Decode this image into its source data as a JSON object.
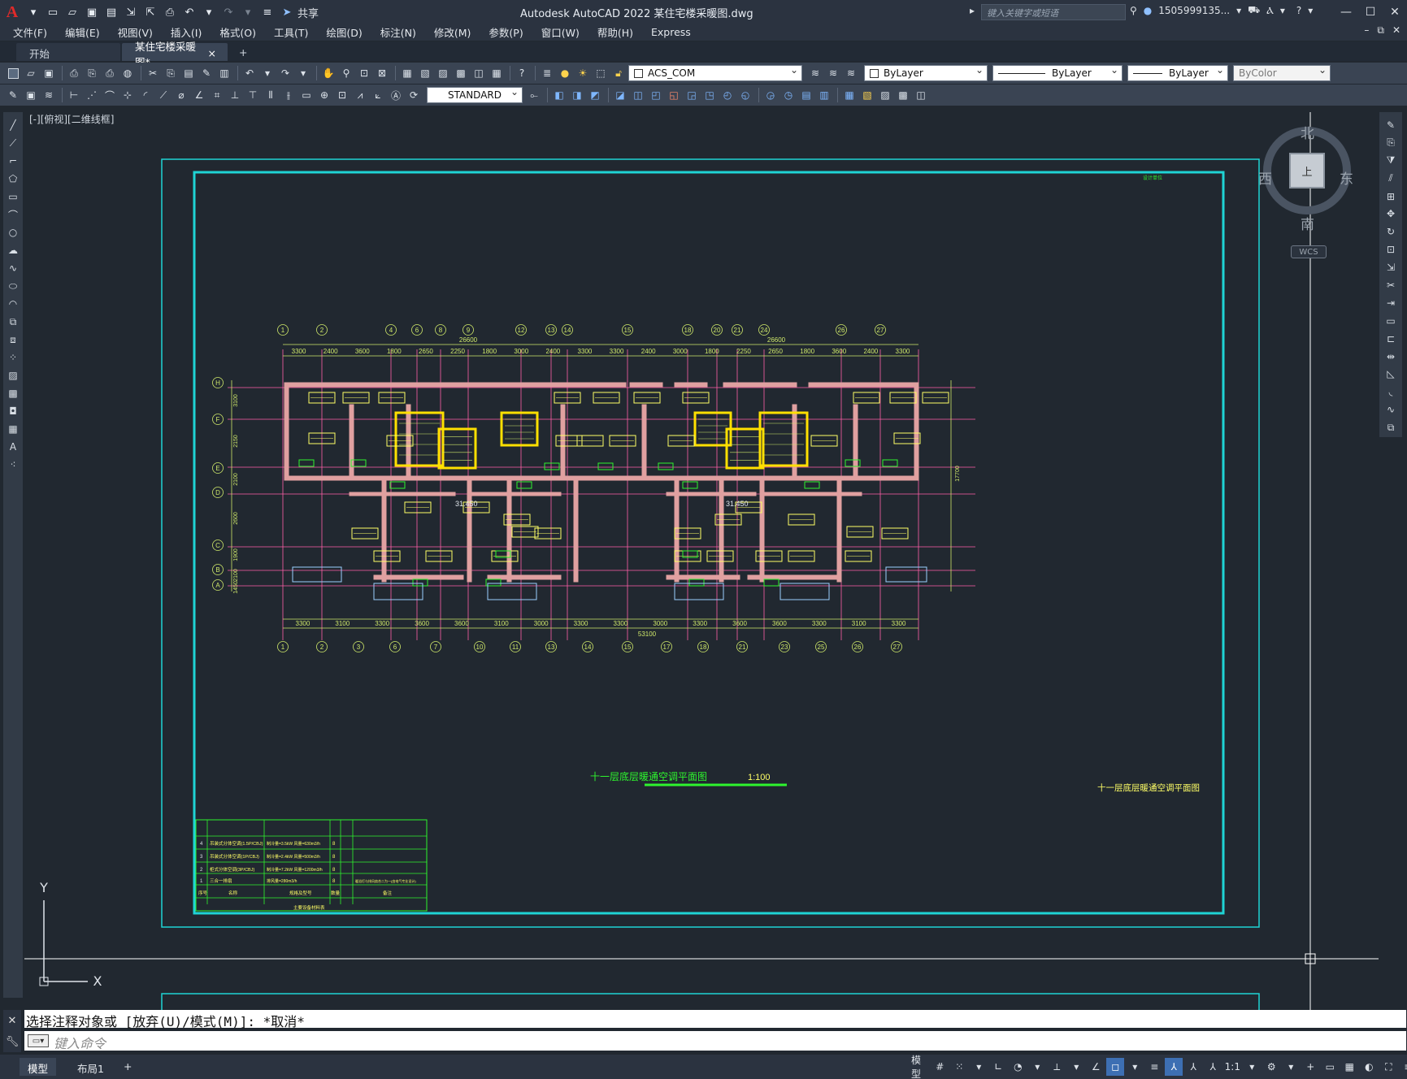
{
  "titlebar": {
    "app_title": "Autodesk AutoCAD 2022    某住宅楼采暖图.dwg",
    "share_label": "共享",
    "search_placeholder": "键入关键字或短语",
    "user_name": "1505999135...",
    "logo": "A"
  },
  "menu": {
    "items": [
      "文件(F)",
      "编辑(E)",
      "视图(V)",
      "插入(I)",
      "格式(O)",
      "工具(T)",
      "绘图(D)",
      "标注(N)",
      "修改(M)",
      "参数(P)",
      "窗口(W)",
      "帮助(H)",
      "Express"
    ]
  },
  "tabs": {
    "start": "开始",
    "active": "某住宅楼采暖图*",
    "close": "×",
    "add": "+"
  },
  "toolbar": {
    "layer_value": "ACS_COM",
    "color_value": "ByLayer",
    "linetype_value": "ByLayer",
    "lineweight_value": "ByLayer",
    "plotstyle_value": "ByColor",
    "text_style_value": "STANDARD"
  },
  "viewport": {
    "label": "[-][俯视][二维线框]",
    "viewcube": {
      "north": "北",
      "south": "南",
      "east": "东",
      "west": "西",
      "face": "上",
      "wcs": "WCS"
    }
  },
  "drawing": {
    "plan_title": "十一层底层暖通空调平面图",
    "plan_scale": "1:100",
    "side_title": "十一层底层暖通空调平面图",
    "top_note": "设计单位",
    "dim_total_top": "26600",
    "dim_total_top2": "26600",
    "dim_total_bottom": "53100",
    "dims_top": [
      "3300",
      "2400",
      "3600",
      "1800",
      "2650",
      "2250",
      "1800",
      "3000",
      "2400",
      "3300",
      "3300",
      "2400",
      "3000",
      "1800",
      "2250",
      "2650",
      "1800",
      "3600",
      "2400",
      "3300"
    ],
    "dims_bottom": [
      "3300",
      "3100",
      "3300",
      "3600",
      "3600",
      "3100",
      "3000",
      "3300",
      "3300",
      "3000",
      "3300",
      "3600",
      "3600",
      "3300",
      "3100",
      "3300"
    ],
    "axis_top": [
      "1",
      "2",
      "4",
      "6",
      "8",
      "9",
      "12",
      "13",
      "14",
      "15",
      "18",
      "20",
      "21",
      "24",
      "26",
      "27"
    ],
    "axis_bottom": [
      "1",
      "2",
      "3",
      "6",
      "7",
      "10",
      "11",
      "13",
      "14",
      "15",
      "17",
      "18",
      "21",
      "23",
      "25",
      "26",
      "27"
    ],
    "axis_left": [
      "H",
      "F",
      "E",
      "D",
      "C",
      "B",
      "A"
    ],
    "dims_left": [
      "3100",
      "2150",
      "2100",
      "2600",
      "1900",
      "2100",
      "1450"
    ],
    "dims_right_total": "17700",
    "elev_labels": [
      "31.450",
      "31.450"
    ],
    "table": {
      "rows": [
        {
          "no": "4",
          "name": "吊装式分体空调(1.5P/CBJ)",
          "spec": "制冷量=3.5kW 风量=630m3/h",
          "qty": "8"
        },
        {
          "no": "3",
          "name": "吊装式分体空调(1P/CBJ)",
          "spec": "制冷量=2.4kW 风量=500m3/h",
          "qty": "8"
        },
        {
          "no": "2",
          "name": "柜式分体空调(3P/CBJ)",
          "spec": "制冷量=7.2kW 风量=1200m3/h",
          "qty": "8"
        },
        {
          "no": "1",
          "name": "三合一排扇",
          "spec": "排风量=280m3/h",
          "qty": "8",
          "note": "暖浴灯与排风扇合二为一(由电气专业设计)"
        }
      ],
      "header": {
        "no": "序号",
        "name": "名称",
        "spec": "规格及型号",
        "qty": "数量",
        "note": "备注"
      },
      "footer": "主要设备材料表"
    }
  },
  "ucs": {
    "x": "X",
    "y": "Y"
  },
  "command": {
    "history": "选择注释对象或 [放弃(U)/模式(M)]: *取消*",
    "placeholder": "键入命令"
  },
  "status": {
    "model_tab": "模型",
    "layout_tab": "布局1",
    "add": "+",
    "model_space": "模型",
    "scale": "1:1"
  }
}
